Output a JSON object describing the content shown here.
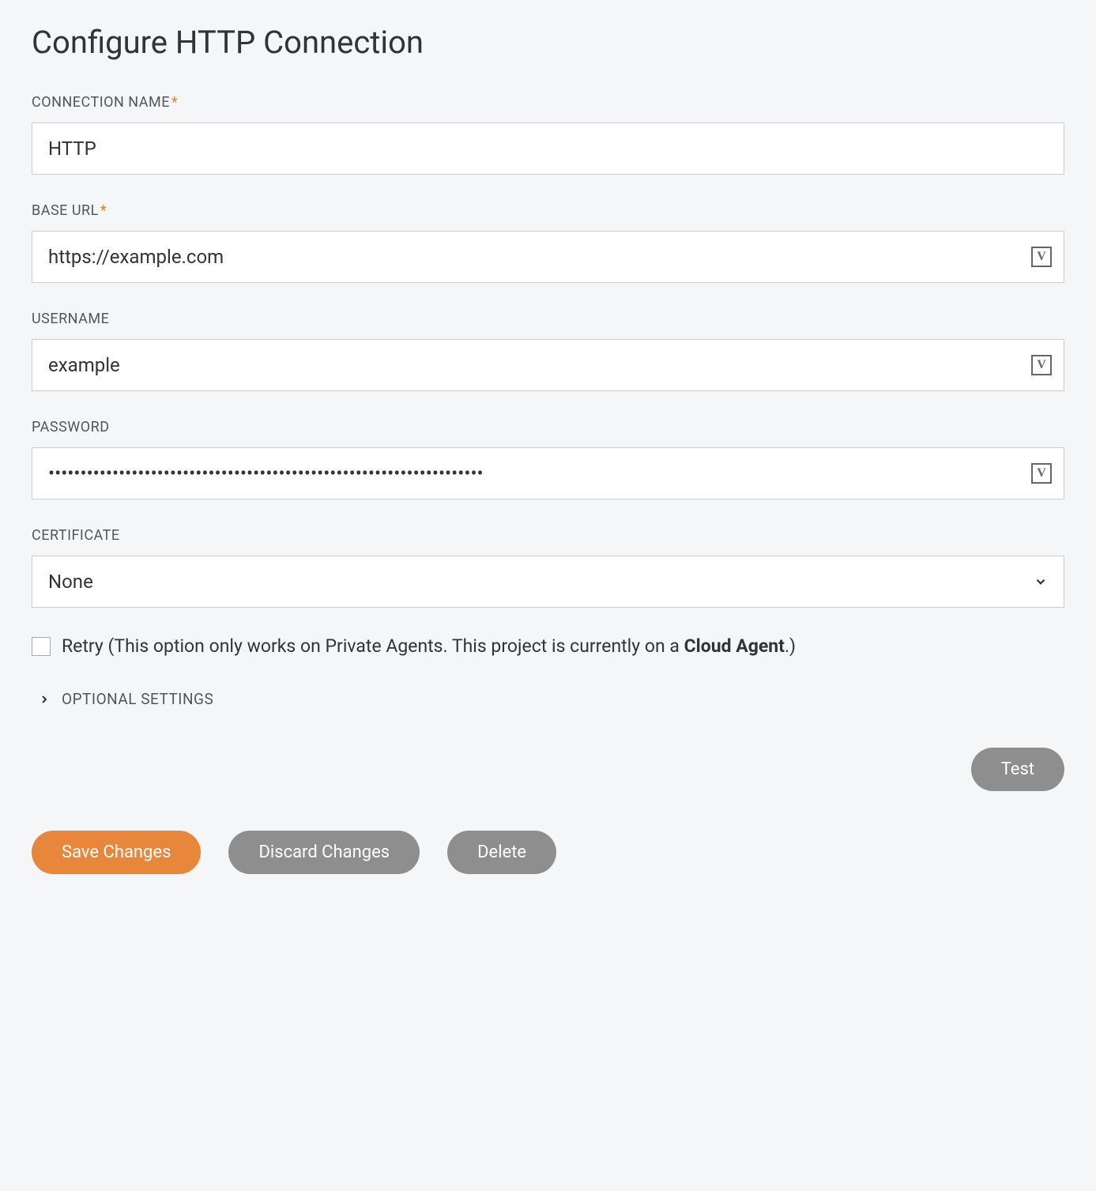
{
  "title": "Configure HTTP Connection",
  "fields": {
    "connection_name": {
      "label": "CONNECTION NAME",
      "required": true,
      "value": "HTTP"
    },
    "base_url": {
      "label": "BASE URL",
      "required": true,
      "value": "https://example.com"
    },
    "username": {
      "label": "USERNAME",
      "required": false,
      "value": "example"
    },
    "password": {
      "label": "PASSWORD",
      "required": false,
      "value": "••••••••••••••••••••••••••••••••••••••••••••••••••••••••••••••••••••"
    },
    "certificate": {
      "label": "CERTIFICATE",
      "required": false,
      "selected": "None"
    }
  },
  "retry": {
    "label_prefix": "Retry (This option only works on Private Agents. This project is currently on a ",
    "label_bold": "Cloud Agent",
    "label_suffix": ".)",
    "checked": false
  },
  "optional_settings_label": "OPTIONAL SETTINGS",
  "buttons": {
    "test": "Test",
    "save": "Save Changes",
    "discard": "Discard Changes",
    "delete": "Delete"
  }
}
